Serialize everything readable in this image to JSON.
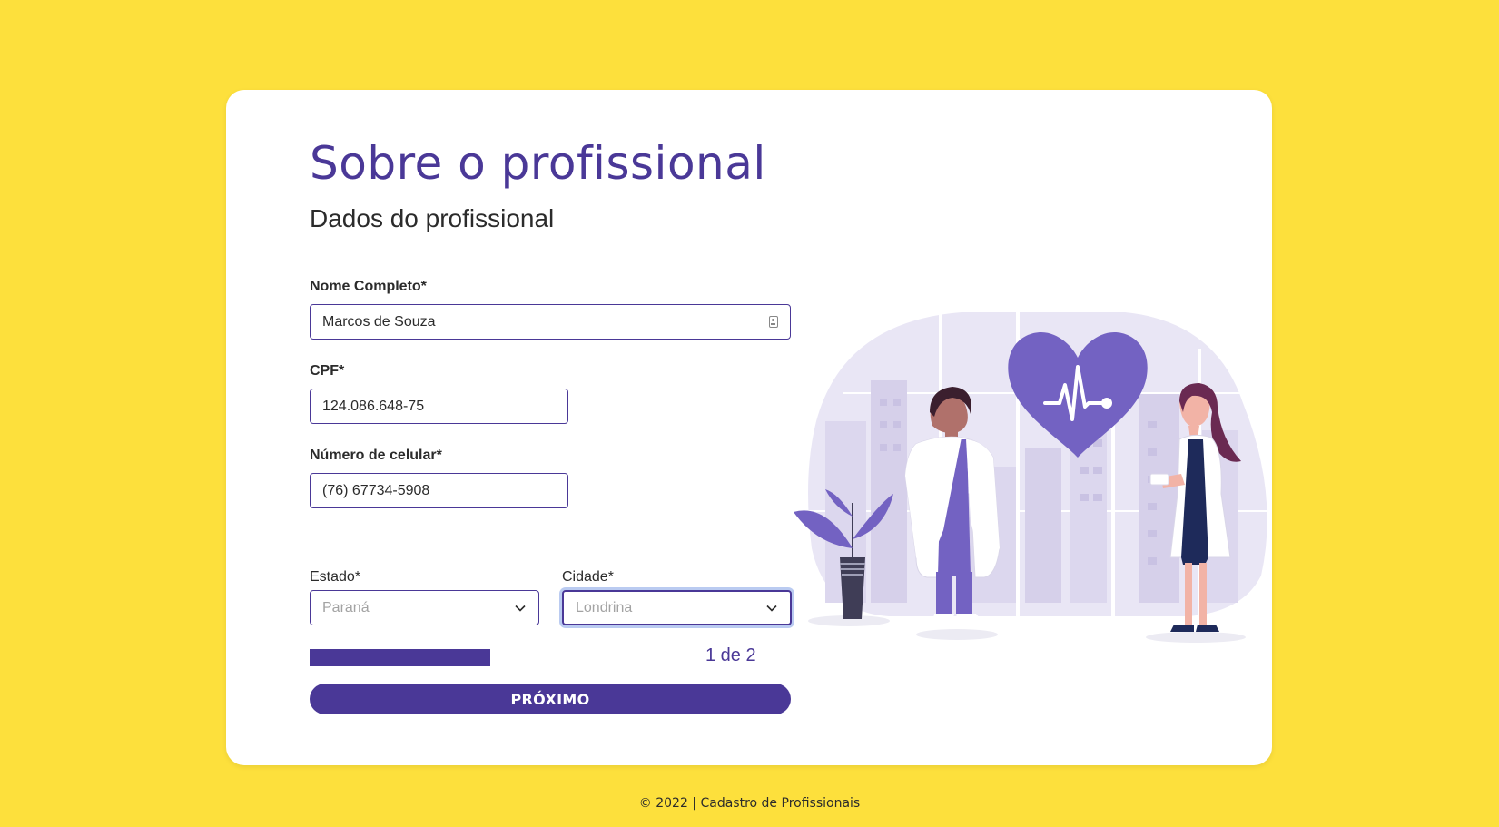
{
  "page": {
    "title": "Sobre o profissional",
    "subtitle": "Dados do profissional",
    "footer": "© 2022 | Cadastro de Profissionais"
  },
  "colors": {
    "background": "#fde03c",
    "accent": "#4a3897",
    "illustration_purple": "#7362c2"
  },
  "form": {
    "nome": {
      "label": "Nome Completo*",
      "value": "Marcos de Souza",
      "icon": "contact-card-icon"
    },
    "cpf": {
      "label": "CPF*",
      "value": "124.086.648-75"
    },
    "celular": {
      "label": "Número de celular*",
      "value": "(76) 67734-5908"
    },
    "estado": {
      "label": "Estado*",
      "selected": "Paraná",
      "icon": "chevron-down-icon"
    },
    "cidade": {
      "label": "Cidade*",
      "selected": "Londrina",
      "icon": "chevron-down-icon"
    }
  },
  "progress": {
    "step_text": "1 de 2",
    "current_step": 1,
    "total_steps": 2
  },
  "actions": {
    "next_label": "PRÓXIMO"
  },
  "illustration": {
    "icon": "doctors-heart-illustration"
  }
}
